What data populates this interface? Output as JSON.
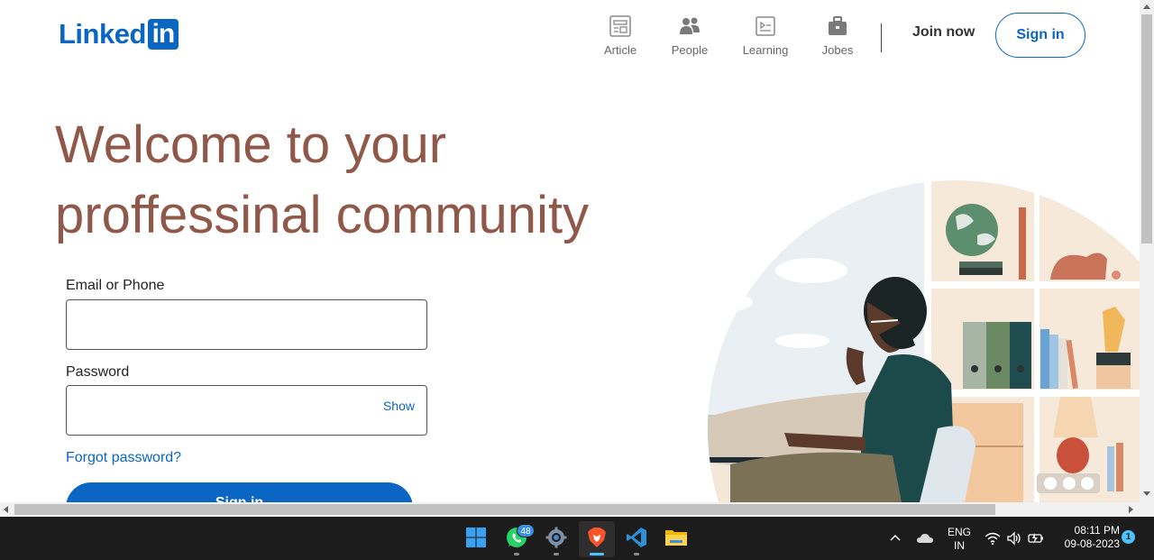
{
  "header": {
    "logo_text": "Linked",
    "logo_box": "in",
    "nav": [
      {
        "label": "Article",
        "icon": "article-icon"
      },
      {
        "label": "People",
        "icon": "people-icon"
      },
      {
        "label": "Learning",
        "icon": "learning-icon"
      },
      {
        "label": "Jobes",
        "icon": "briefcase-icon"
      }
    ],
    "join_now": "Join now",
    "sign_in": "Sign in"
  },
  "hero": {
    "title_line1": "Welcome to your",
    "title_line2": "proffessinal community"
  },
  "form": {
    "email_label": "Email or Phone",
    "email_value": "",
    "password_label": "Password",
    "password_value": "",
    "show_label": "Show",
    "forgot_label": "Forgot password?",
    "submit_label": "Sign in"
  },
  "colors": {
    "brand": "#0a66c2",
    "hero_text": "#8f5849",
    "taskbar": "#1c1c1c"
  },
  "taskbar": {
    "apps": [
      {
        "name": "start",
        "icon": "windows-icon"
      },
      {
        "name": "whatsapp",
        "icon": "whatsapp-icon",
        "badge": "48"
      },
      {
        "name": "settings",
        "icon": "settings-gear-icon"
      },
      {
        "name": "brave",
        "icon": "brave-browser-icon",
        "active": true
      },
      {
        "name": "vscode",
        "icon": "vscode-icon"
      },
      {
        "name": "file-explorer",
        "icon": "folder-icon"
      }
    ],
    "lang_line1": "ENG",
    "lang_line2": "IN",
    "time": "08:11 PM",
    "date": "09-08-2023",
    "notifications": "1"
  }
}
